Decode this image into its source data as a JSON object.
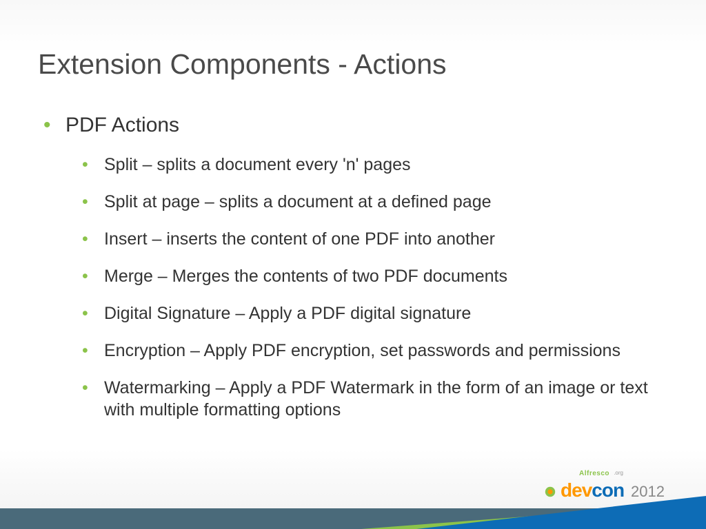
{
  "slide": {
    "title": "Extension Components - Actions",
    "section": "PDF Actions",
    "items": [
      "Split – splits a document every 'n' pages",
      "Split at page – splits a document at a defined page",
      "Insert – inserts the content of one PDF into another",
      "Merge – Merges the contents of two PDF documents",
      "Digital Signature – Apply a PDF digital signature",
      "Encryption – Apply PDF encryption, set passwords and permissions",
      "Watermarking – Apply a PDF Watermark in the form of an image or text with multiple formatting options"
    ]
  },
  "logo": {
    "alfresco": "Alfresco",
    "org": ".org",
    "dev": "dev",
    "con": "con",
    "year": "2012"
  }
}
